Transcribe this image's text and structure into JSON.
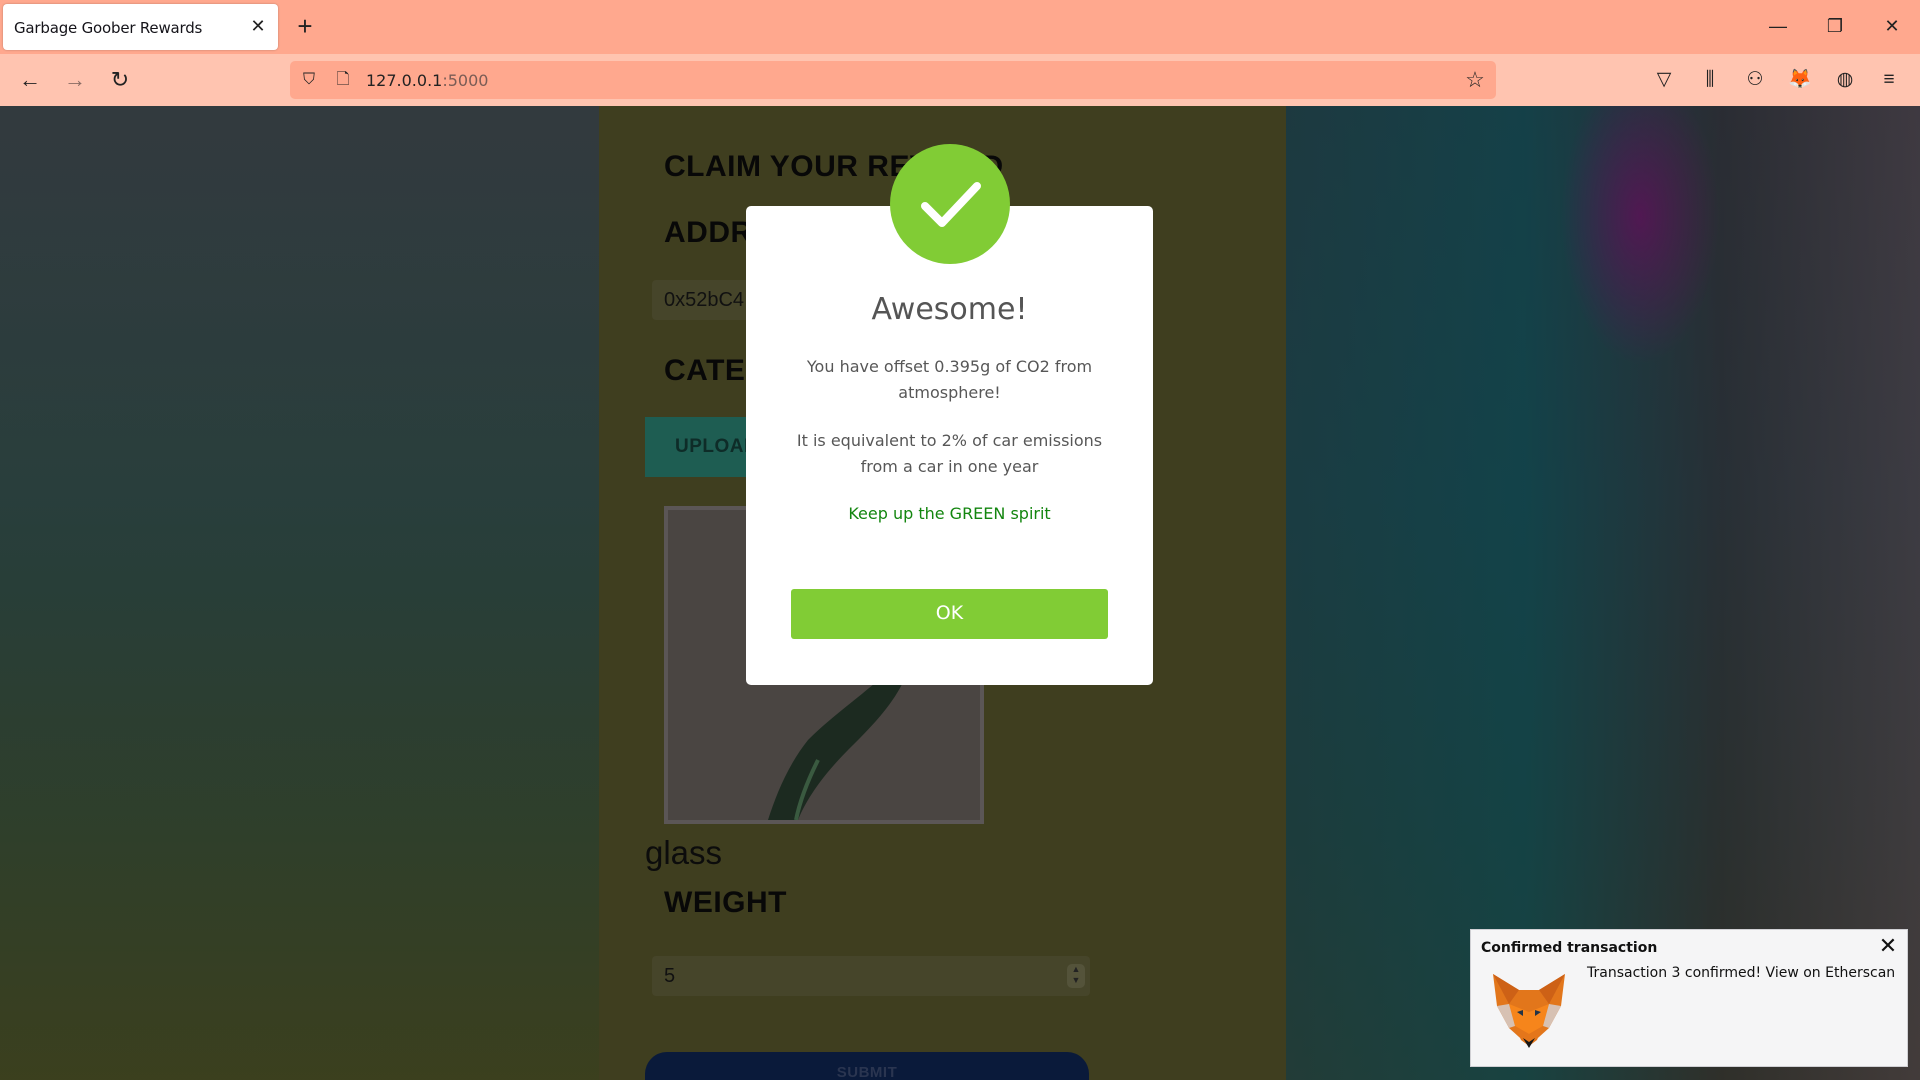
{
  "browser": {
    "tab_title": "Garbage Goober Rewards",
    "tab_close": "✕",
    "new_tab": "+",
    "url_host": "127.0.0.1",
    "url_port": ":5000",
    "icons": {
      "back": "←",
      "forward": "→",
      "reload": "↻",
      "shield": "⛉",
      "page": "🗋",
      "star": "☆",
      "pocket": "▽",
      "library": "⫼",
      "extension": "⚇",
      "metamask": "🦊",
      "globe": "◍",
      "menu": "≡",
      "minimize": "—",
      "restore": "❐",
      "close": "✕"
    }
  },
  "form": {
    "claim_heading": "CLAIM YOUR REWARD",
    "address_heading": "ADDRESS",
    "address_value": "0x52bC4",
    "category_heading": "CATEGORY",
    "upload_label": "UPLOAD",
    "detected_category": "glass",
    "weight_heading": "WEIGHT",
    "weight_value": "5",
    "submit_label": "SUBMIT"
  },
  "modal": {
    "title": "Awesome!",
    "line1": "You have offset 0.395g of CO2 from atmosphere!",
    "line2": "It is equivalent to 2% of car emissions from a car in one year",
    "line3": "Keep up the GREEN spirit",
    "ok_label": "OK",
    "accent_color": "#81cc35"
  },
  "toast": {
    "title": "Confirmed transaction",
    "body": "Transaction 3 confirmed! View on Etherscan",
    "close": "✕"
  }
}
